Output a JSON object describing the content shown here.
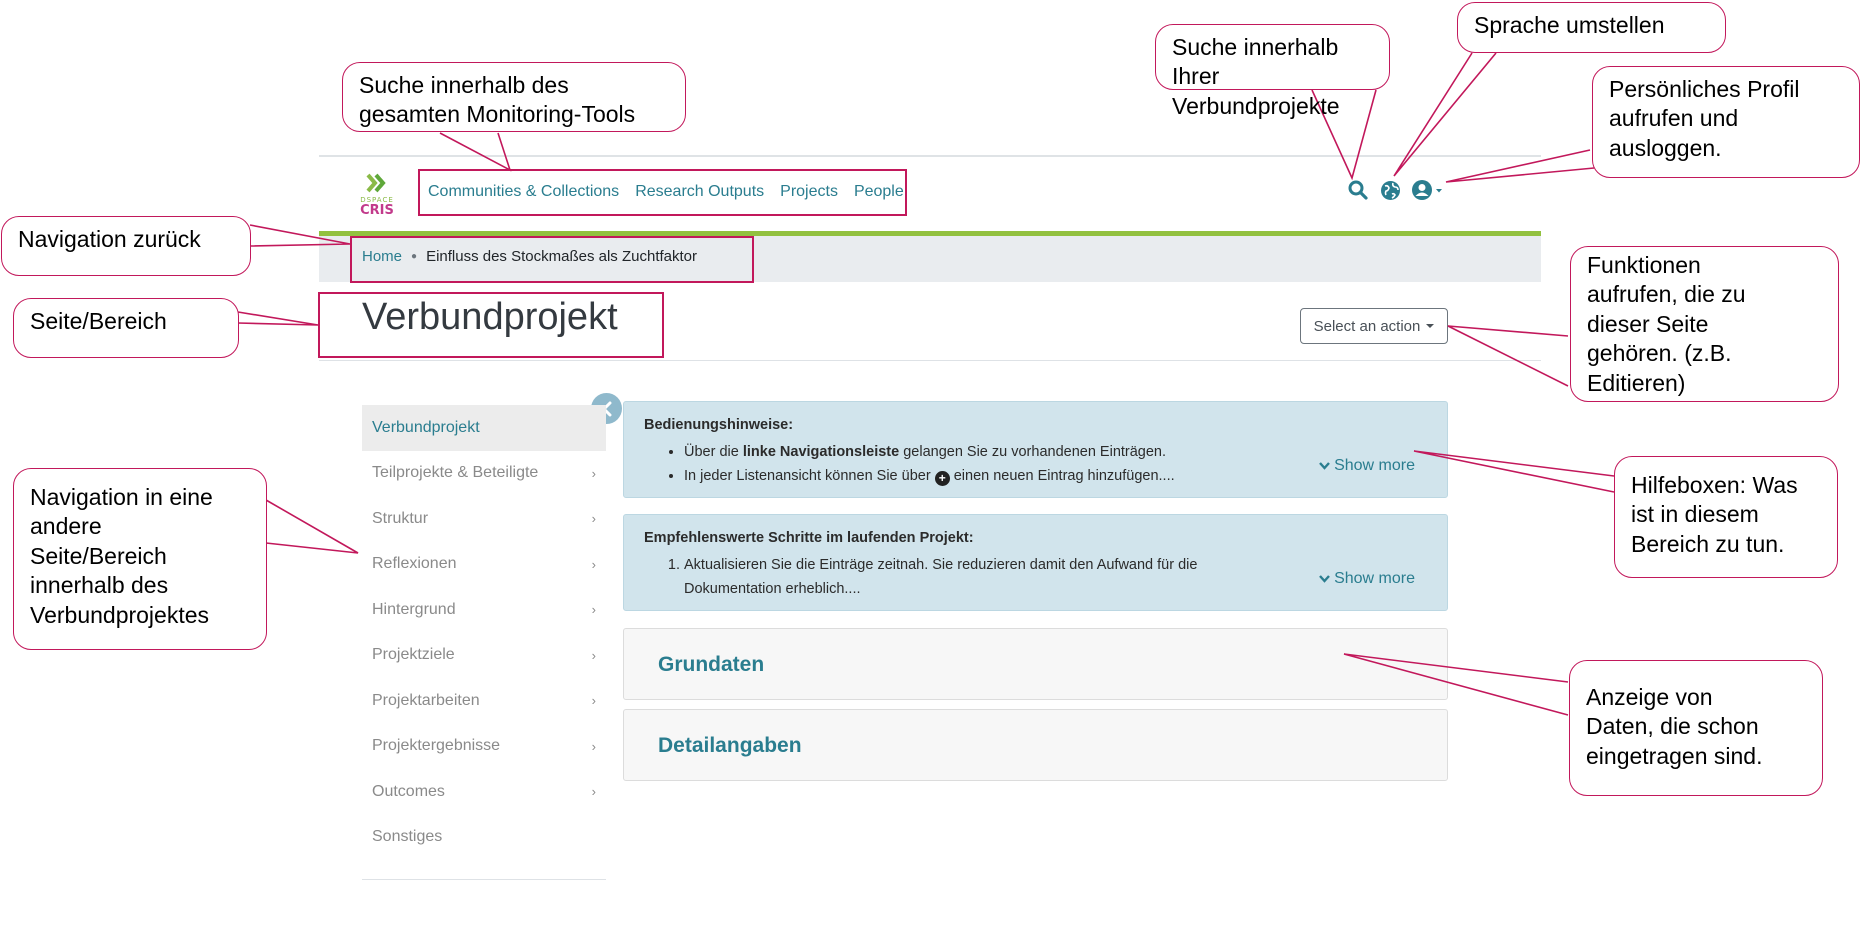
{
  "header": {
    "logo_top": "DSPACE",
    "logo_bottom": "CRIS",
    "nav": [
      {
        "label": "Communities & Collections"
      },
      {
        "label": "Research Outputs"
      },
      {
        "label": "Projects"
      },
      {
        "label": "People"
      }
    ],
    "icons": [
      "search-icon",
      "globe-icon",
      "user-circle-icon"
    ]
  },
  "breadcrumb": {
    "home": "Home",
    "current": "Einfluss des Stockmaßes als Zuchtfaktor"
  },
  "page": {
    "title": "Verbundprojekt",
    "action_label": "Select an action"
  },
  "sidebar": {
    "items": [
      {
        "label": "Verbundprojekt",
        "active": true
      },
      {
        "label": "Teilprojekte & Beteiligte"
      },
      {
        "label": "Struktur"
      },
      {
        "label": "Reflexionen"
      },
      {
        "label": "Hintergrund"
      },
      {
        "label": "Projektziele"
      },
      {
        "label": "Projektarbeiten"
      },
      {
        "label": "Projektergebnisse"
      },
      {
        "label": "Outcomes"
      },
      {
        "label": "Sonstiges"
      }
    ]
  },
  "help": {
    "box1": {
      "title": "Bedienungshinweise:",
      "line1_pre": "Über die ",
      "line1_bold": "linke Navigationsleiste",
      "line1_post": " gelangen Sie zu vorhandenen Einträgen.",
      "line2_pre": "In jeder Listenansicht können Sie über ",
      "line2_post": " einen neuen Eintrag hinzufügen....",
      "show_more": "Show more"
    },
    "box2": {
      "title": "Empfehlenswerte Schritte im laufenden Projekt:",
      "item1_line1": "Aktualisieren Sie die Einträge zeitnah. Sie reduzieren damit den Aufwand für die",
      "item1_line2": "Dokumentation erheblich....",
      "show_more": "Show more"
    }
  },
  "panels": [
    {
      "title": "Grundaten"
    },
    {
      "title": "Detailangaben"
    }
  ],
  "callouts": {
    "search_all_l1": "Suche innerhalb des",
    "search_all_l2": "gesamten Monitoring-Tools",
    "search_projects_l1": "Suche innerhalb",
    "search_projects_l2": "Ihrer Verbundprojekte",
    "language": "Sprache umstellen",
    "profile_l1": "Persönliches Profil",
    "profile_l2": "aufrufen und",
    "profile_l3": "ausloggen.",
    "nav_back": "Navigation zurück",
    "page_area": "Seite/Bereich",
    "functions_l1": "Funktionen",
    "functions_l2": "aufrufen, die zu",
    "functions_l3": "dieser Seite",
    "functions_l4": "gehören. (z.B.",
    "functions_l5": "Editieren)",
    "help_l1": "Hilfeboxen: Was",
    "help_l2": "ist in diesem",
    "help_l3": "Bereich zu tun.",
    "nav_other_l1": "Navigation in eine",
    "nav_other_l2": "andere",
    "nav_other_l3": "Seite/Bereich",
    "nav_other_l4": "innerhalb des",
    "nav_other_l5": "Verbundprojektes",
    "data_l1": "Anzeige von",
    "data_l2": "Daten, die schon",
    "data_l3": "eingetragen sind."
  },
  "colors": {
    "accent": "#2a7d8f",
    "green_bar": "#92c13f",
    "annotation": "#c2185b",
    "help_bg": "#d1e4ec"
  }
}
